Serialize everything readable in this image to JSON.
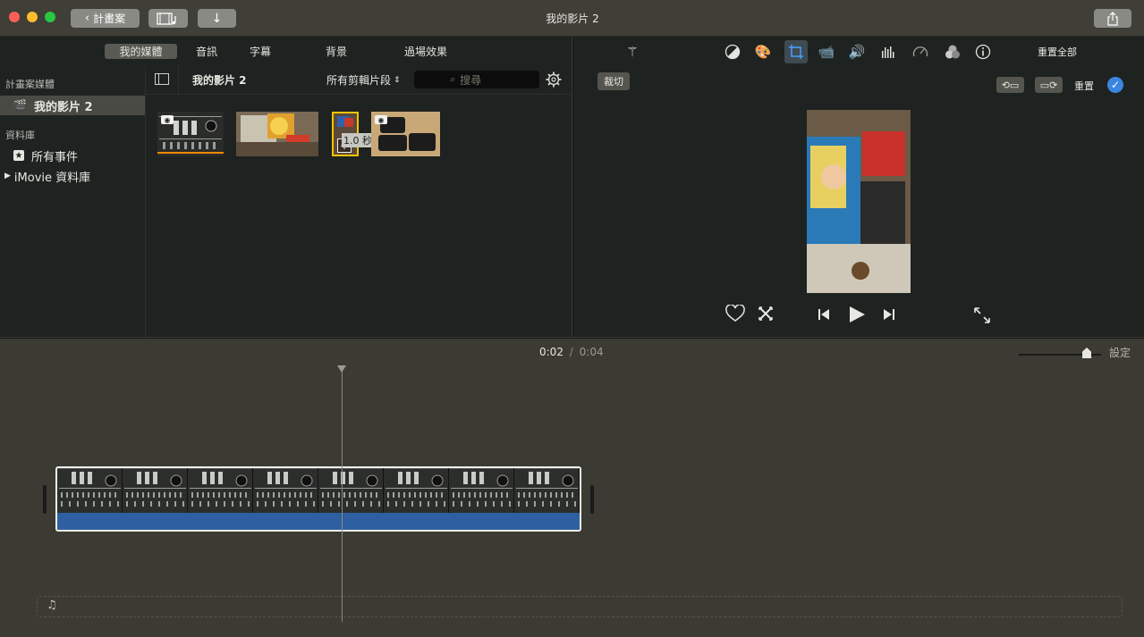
{
  "window": {
    "title": "我的影片 2",
    "back_label": "計畫案"
  },
  "browser": {
    "tabs": [
      "我的媒體",
      "音訊",
      "字幕",
      "背景",
      "過場效果"
    ],
    "active_tab": "我的媒體",
    "sidebar": {
      "section_project": "計畫案媒體",
      "project_item": "我的影片 2",
      "section_library": "資料庫",
      "all_events": "所有事件",
      "library_item": "iMovie 資料庫"
    },
    "clip_header": {
      "title": "我的影片 2",
      "filter": "所有剪輯片段",
      "search_placeholder": "搜尋"
    },
    "drag_tooltip": "1.0 秒"
  },
  "viewer": {
    "reset_all": "重置全部",
    "crop_label": "裁切",
    "reset_label": "重置"
  },
  "timeline": {
    "current_time": "0:02",
    "separator": "/",
    "total_time": "0:04",
    "settings_label": "設定",
    "zoom_level": 0.86
  },
  "colors": {
    "accent_blue": "#2e5fa0",
    "selection_yellow": "#f5c400",
    "check_blue": "#3a86e0"
  }
}
